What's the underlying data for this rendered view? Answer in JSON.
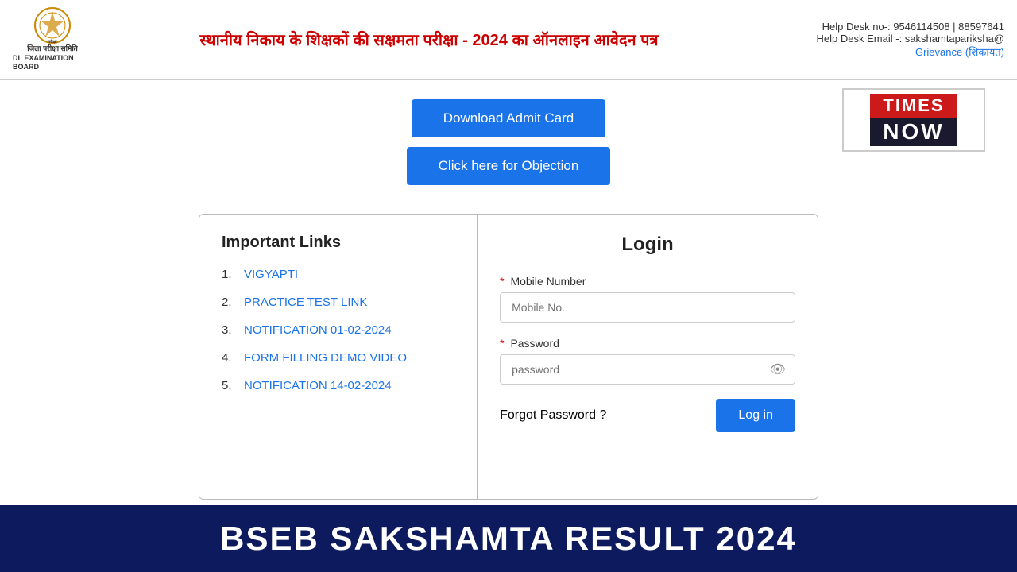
{
  "header": {
    "logo_line1": "जिला परीक्षा समिति",
    "logo_line2": "DL EXAMINATION BOARD",
    "title": "स्थानीय निकाय के शिक्षकों की सक्षमता परीक्षा - 2024 का ऑनलाइन आवेदन पत्र",
    "helpdesk_no": "Help Desk no-: 9546114508 | 88597641",
    "helpdesk_email": "Help Desk Email -: sakshamtapariksha@",
    "grievance": "Grievance (शिकायत)"
  },
  "buttons": {
    "admit_card": "Download Admit Card",
    "objection": "Click here for Objection"
  },
  "times_now": {
    "top": "TIMES",
    "bottom": "NOW"
  },
  "important_links": {
    "heading": "Important Links",
    "links": [
      {
        "num": "1.",
        "text": "VIGYAPTI"
      },
      {
        "num": "2.",
        "text": "PRACTICE TEST LINK"
      },
      {
        "num": "3.",
        "text": "NOTIFICATION 01-02-2024"
      },
      {
        "num": "4.",
        "text": "FORM FILLING DEMO VIDEO"
      },
      {
        "num": "5.",
        "text": "NOTIFICATION 14-02-2024"
      }
    ]
  },
  "login": {
    "heading": "Login",
    "mobile_label": "Mobile Number",
    "mobile_placeholder": "Mobile No.",
    "password_label": "Password",
    "password_placeholder": "password",
    "forgot_password": "Forgot Password ?",
    "login_button": "Log in"
  },
  "banner": {
    "text": "BSEB SAKSHAMTA RESULT 2024"
  }
}
